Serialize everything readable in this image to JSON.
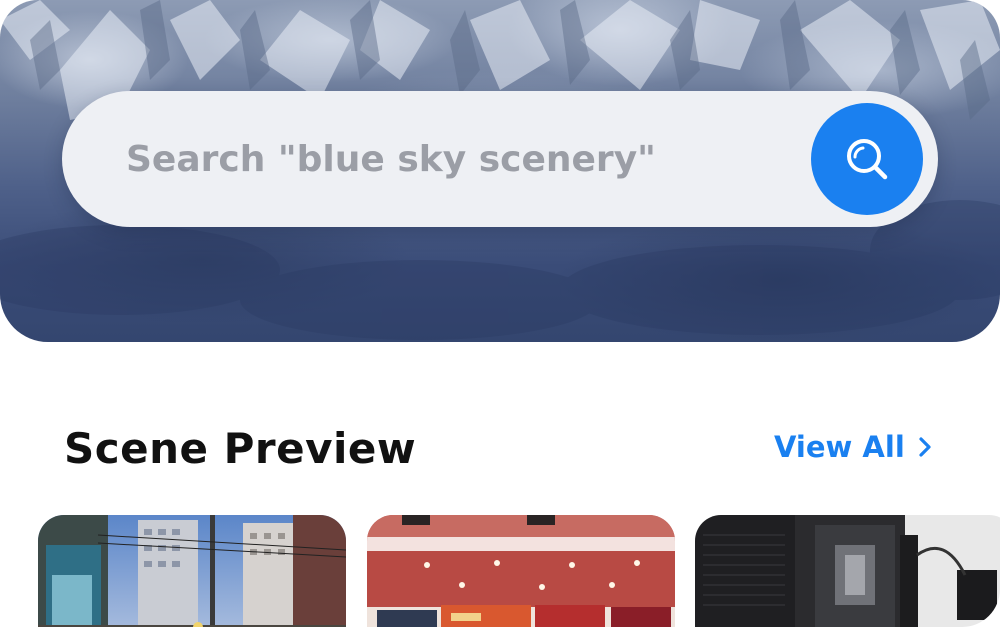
{
  "search": {
    "placeholder": "Search \"blue sky scenery\"",
    "value": "",
    "button_icon": "search-icon",
    "accent_color": "#1a80f0"
  },
  "scene_preview": {
    "title": "Scene Preview",
    "view_all_label": "View All",
    "view_all_icon": "chevron-right-icon",
    "thumbnails": [
      {
        "subject": "city street at dusk"
      },
      {
        "subject": "shop interior with red ceiling"
      },
      {
        "subject": "black computer case"
      }
    ]
  }
}
